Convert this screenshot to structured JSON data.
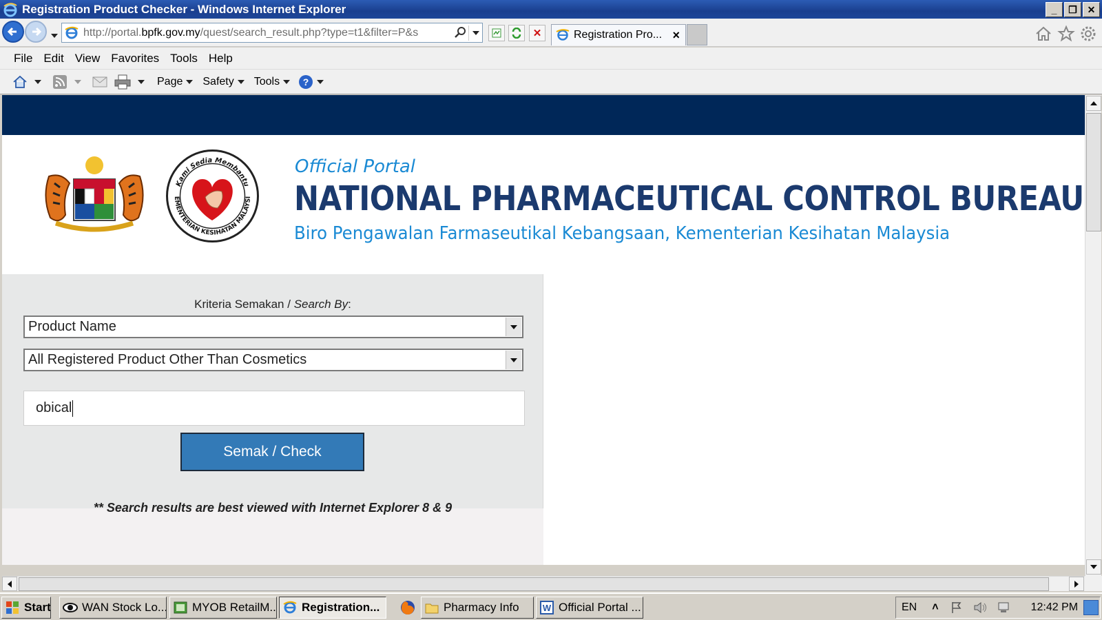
{
  "window": {
    "title": "Registration Product Checker - Windows Internet Explorer",
    "min_glyph": "_",
    "max_glyph": "❐",
    "close_glyph": "✕"
  },
  "address": {
    "prefix": "http://portal.",
    "domain": "bpfk.gov.my",
    "path": "/quest/search_result.php?type=t1&filter=P&s"
  },
  "tab": {
    "label": "Registration Pro...",
    "close_glyph": "×"
  },
  "menu": [
    "File",
    "Edit",
    "View",
    "Favorites",
    "Tools",
    "Help"
  ],
  "commandbar": {
    "page": "Page",
    "safety": "Safety",
    "tools": "Tools"
  },
  "site": {
    "official_portal": "Official Portal",
    "title": "NATIONAL PHARMACEUTICAL CONTROL BUREAU",
    "subtitle": "Biro Pengawalan Farmaseutikal Kebangsaan, Kementerian Kesihatan Malaysia",
    "seal_top_text": "Kami Sedia Membantu",
    "seal_bottom_text": "KEMENTERIAN KESIHATAN MALAYSIA"
  },
  "search": {
    "criteria_label": "Kriteria Semakan / ",
    "criteria_label_italic": "Search By",
    "criteria_suffix": ":",
    "search_by_value": "Product Name",
    "category_value": "All Registered Product Other Than Cosmetics",
    "query_value": "obical",
    "button_label": "Semak / Check",
    "note": "** Search results are best viewed with Internet Explorer 8 & 9"
  },
  "taskbar": {
    "start": "Start",
    "items": [
      "WAN Stock Lo...",
      "MYOB RetailM...",
      "Registration...",
      "Pharmacy Info",
      "Official Portal ..."
    ],
    "lang": "EN",
    "clock": "12:42 PM"
  },
  "colors": {
    "nav_band": "#002758",
    "button": "#337ab7",
    "title_text": "#1b3a6e",
    "accent_text": "#1a8ad4"
  }
}
